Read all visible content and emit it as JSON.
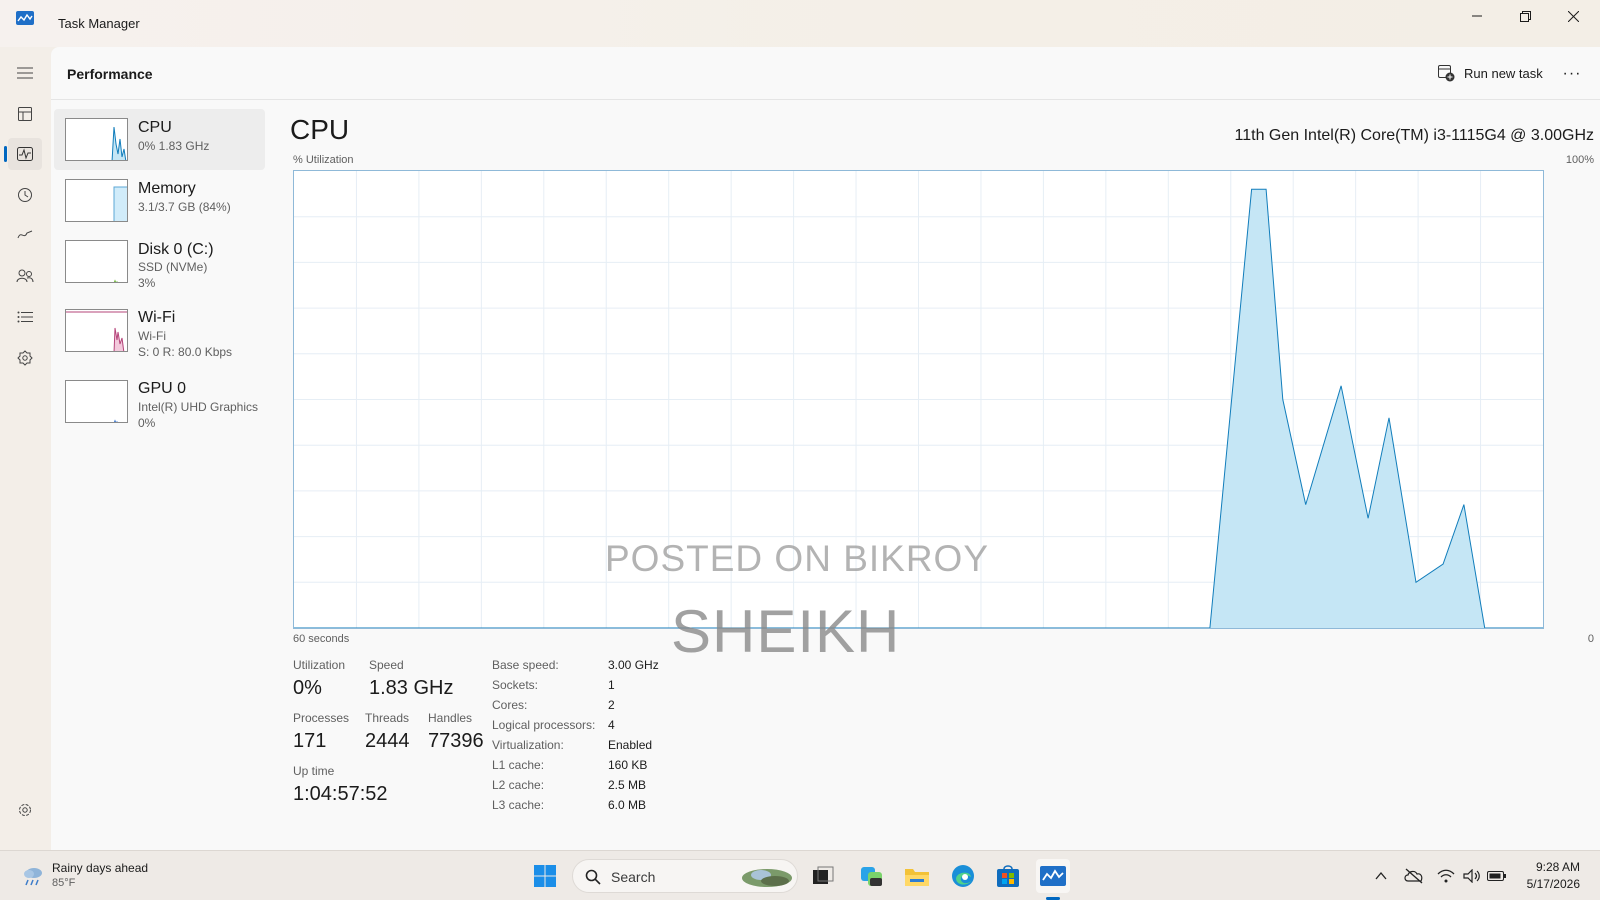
{
  "window": {
    "title": "Task Manager"
  },
  "nav": {
    "items": [
      {
        "icon": "hamburger-menu-icon"
      },
      {
        "icon": "processes-icon"
      },
      {
        "icon": "performance-icon",
        "active": true
      },
      {
        "icon": "app-history-icon"
      },
      {
        "icon": "startup-apps-icon"
      },
      {
        "icon": "users-icon"
      },
      {
        "icon": "details-icon"
      },
      {
        "icon": "services-icon"
      }
    ],
    "settings_icon": "settings-icon"
  },
  "header": {
    "title": "Performance",
    "run_new_task": "Run new task",
    "more": "···"
  },
  "resources": [
    {
      "name": "CPU",
      "sub1": "0%  1.83 GHz",
      "sub2": "",
      "color": "#117dbb",
      "selected": true
    },
    {
      "name": "Memory",
      "sub1": "3.1/3.7 GB (84%)",
      "sub2": "",
      "color": "#8b12ae"
    },
    {
      "name": "Disk 0 (C:)",
      "sub1": "SSD (NVMe)",
      "sub2": "3%",
      "color": "#4da60c"
    },
    {
      "name": "Wi-Fi",
      "sub1": "Wi-Fi",
      "sub2": "S: 0  R: 80.0 Kbps",
      "color": "#a74f01"
    },
    {
      "name": "GPU 0",
      "sub1": "Intel(R) UHD Graphics",
      "sub2": "0%",
      "color": "#0e58c4"
    }
  ],
  "detail": {
    "title": "CPU",
    "processor": "11th Gen Intel(R) Core(TM) i3-1115G4 @ 3.00GHz",
    "y_label": "% Utilization",
    "y_max_label": "100%",
    "x_left_label": "60 seconds",
    "x_right_label": "0",
    "watermark_line1": "POSTED ON BIKROY",
    "watermark_line2": "SHEIKH"
  },
  "stats": {
    "utilization_label": "Utilization",
    "utilization": "0%",
    "speed_label": "Speed",
    "speed": "1.83 GHz",
    "processes_label": "Processes",
    "processes": "171",
    "threads_label": "Threads",
    "threads": "2444",
    "handles_label": "Handles",
    "handles": "77396",
    "uptime_label": "Up time",
    "uptime": "1:04:57:52"
  },
  "specs": [
    {
      "label": "Base speed:",
      "value": "3.00 GHz"
    },
    {
      "label": "Sockets:",
      "value": "1"
    },
    {
      "label": "Cores:",
      "value": "2"
    },
    {
      "label": "Logical processors:",
      "value": "4"
    },
    {
      "label": "Virtualization:",
      "value": "Enabled"
    },
    {
      "label": "L1 cache:",
      "value": "160 KB"
    },
    {
      "label": "L2 cache:",
      "value": "2.5 MB"
    },
    {
      "label": "L3 cache:",
      "value": "6.0 MB"
    }
  ],
  "chart_data": {
    "type": "area",
    "title": "CPU",
    "ylabel": "% Utilization",
    "xlabel": "",
    "xlim": [
      60,
      0
    ],
    "ylim": [
      0,
      100
    ],
    "grid": true,
    "color": "#117dbb",
    "fill": "#c5e6f5",
    "series": [
      {
        "x": [
          60,
          16,
          14,
          13.3,
          12.5,
          11.4,
          9.7,
          8.4,
          7.4,
          6.1,
          4.8,
          3.8,
          2.8,
          0
        ],
        "values": [
          0,
          0,
          96,
          96,
          50,
          27,
          53,
          24,
          46,
          10,
          14,
          27,
          0,
          0
        ]
      }
    ]
  },
  "taskbar": {
    "weather": "Rainy days ahead",
    "temperature": "85°F",
    "search_placeholder": "Search",
    "time": "9:28 AM",
    "date": "5/17/2026",
    "apps": [
      "start-icon",
      "search-icon",
      "task-view-icon",
      "widgets-icon",
      "file-explorer-icon",
      "edge-icon",
      "store-icon",
      "task-manager-icon"
    ]
  }
}
